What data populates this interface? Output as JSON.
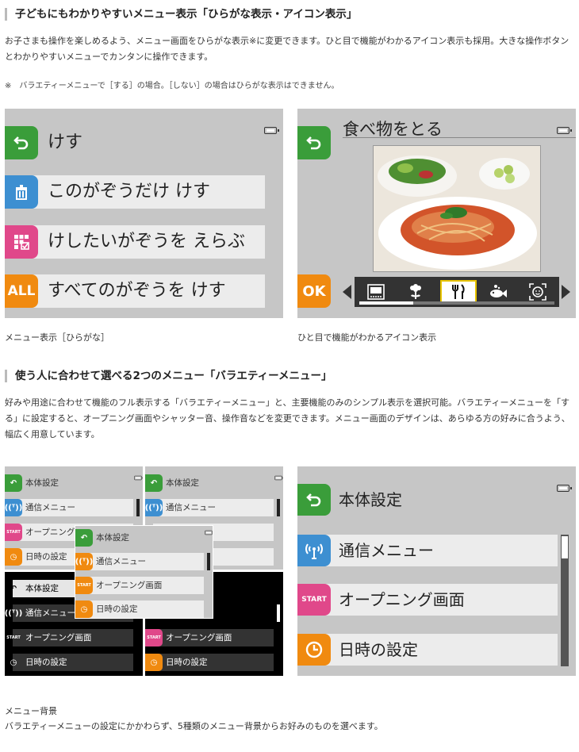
{
  "section1": {
    "heading": "子どもにもわかりやすいメニュー表示「ひらがな表示・アイコン表示」",
    "paragraph": "お子さまも操作を楽しめるよう、メニュー画面をひらがな表示※に変更できます。ひと目で機能がわかるアイコン表示も採用。大きな操作ボタンとわかりやすいメニューでカンタンに操作できます。",
    "note": "※　バラエティーメニューで［する］の場合。［しない］の場合はひらがな表示はできません。",
    "caption_left": "メニュー表示［ひらがな］",
    "caption_right": "ひと目で機能がわかるアイコン表示"
  },
  "hiragana_menu": {
    "items": [
      {
        "label": "けす",
        "icon": "back-arrow-icon",
        "color": "#3a9d3a"
      },
      {
        "label": "このがぞうだけ けす",
        "icon": "trash-icon",
        "color": "#3d8fd1"
      },
      {
        "label": "けしたいがぞうを えらぶ",
        "icon": "select-grid-icon",
        "color": "#e0488a"
      },
      {
        "label": "すべてのがぞうを けす",
        "icon": "all-icon",
        "icon_text": "ALL",
        "color": "#f08a10"
      }
    ]
  },
  "icon_screen": {
    "title": "食べ物をとる",
    "ok_label": "OK",
    "icons": [
      "frame-icon",
      "flower-icon",
      "fork-knife-icon",
      "fish-icon",
      "face-icon"
    ],
    "selected_index": 2
  },
  "section2": {
    "heading": "使う人に合わせて選べる2つのメニュー「バラエティーメニュー」",
    "paragraph": "好みや用途に合わせて機能のフル表示する「バラエティーメニュー」と、主要機能のみのシンプル表示を選択可能。バラエティーメニューを「する」に設定すると、オープニング画面やシャッター音、操作音などを変更できます。メニュー画面のデザインは、あらゆる方の好みに合うよう、幅広く用意しています。",
    "caption_title": "メニュー背景",
    "caption_text": "バラエティーメニューの設定にかかわらず、5種類のメニュー背景からお好みのものを選べます。"
  },
  "variety_menu": {
    "items": [
      {
        "label": "本体設定",
        "icon": "back-arrow-icon",
        "color": "#3a9d3a"
      },
      {
        "label": "通信メニュー",
        "icon": "antenna-icon",
        "color": "#3d8fd1"
      },
      {
        "label": "オープニング画面",
        "icon": "start-icon",
        "icon_text": "START",
        "color": "#e0488a"
      },
      {
        "label": "日時の設定",
        "icon": "clock-icon",
        "color": "#f08a10"
      }
    ]
  }
}
